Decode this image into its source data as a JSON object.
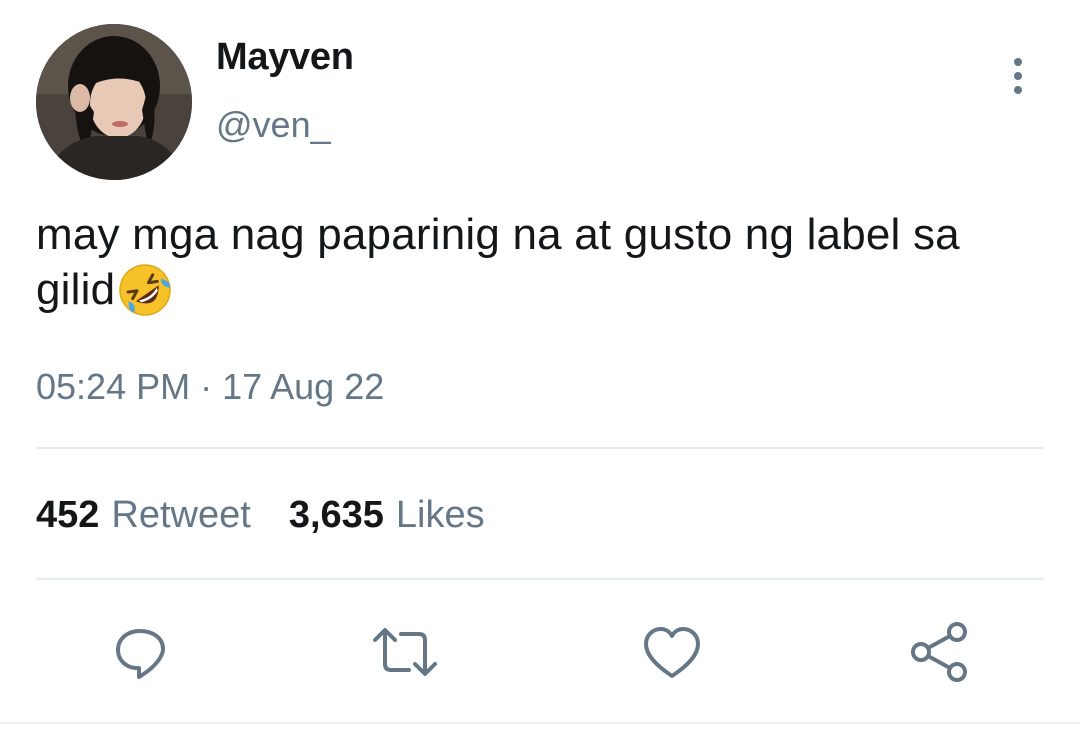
{
  "tweet": {
    "author": {
      "display_name": "Mayven",
      "handle": "@ven_",
      "avatar": "user-avatar-photo"
    },
    "text": "may mga nag paparinig na at gusto ng label sa gilid",
    "emoji": "rolling-on-floor-laughing",
    "timestamp": "05:24 PM · 17 Aug 22",
    "stats": {
      "retweets_count": "452",
      "retweets_label": "Retweet",
      "likes_count": "3,635",
      "likes_label": "Likes"
    },
    "actions": [
      "reply-icon",
      "retweet-icon",
      "like-icon",
      "share-icon"
    ]
  },
  "colors": {
    "text": "#14171a",
    "secondary": "#657786",
    "divider": "#e6ecf0",
    "emoji_yellow": "#f7c12a"
  }
}
